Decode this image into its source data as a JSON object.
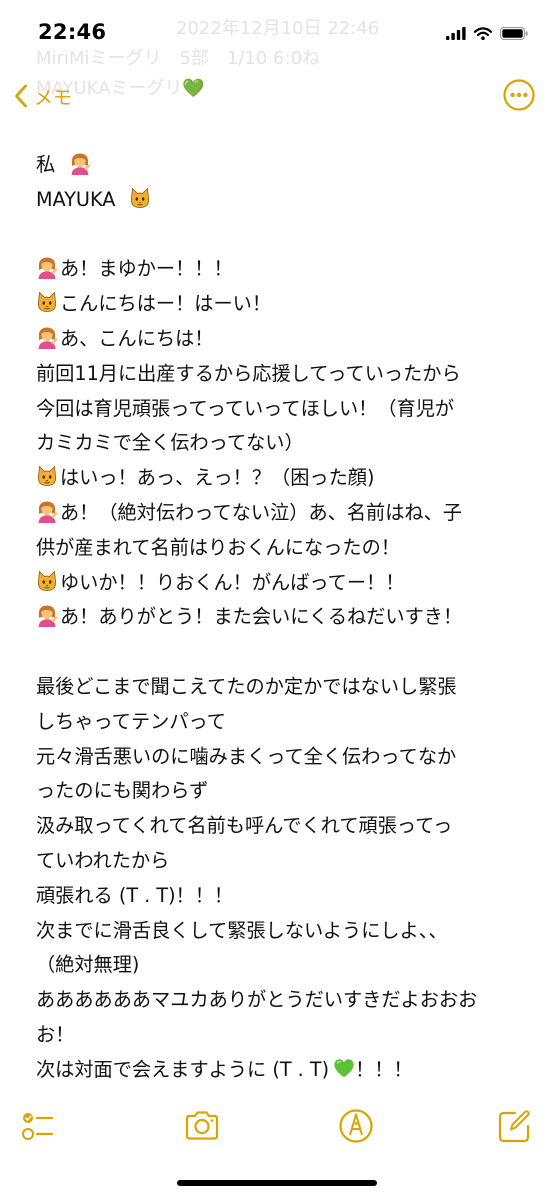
{
  "status_bar": {
    "time": "22:46",
    "icons": [
      "signal-icon",
      "wifi-icon",
      "battery-icon"
    ]
  },
  "ghost_header": {
    "line1": "2022年12月10日 22:46",
    "line2": "MiriMiミーグリ　5部　1/10 6:0ね",
    "line3": "MAYUKAミーグリ💚"
  },
  "nav": {
    "back_label": "メモ",
    "more_icon": "ellipsis-circle-icon"
  },
  "note": {
    "header_me": "私",
    "header_mayuka": "MAYUKA",
    "lines": [
      "あ！まゆかー！！！",
      "こんにちはー！はーい！",
      "あ、こんにちは！",
      "前回11月に出産するから応援してっていったから",
      "今回は育児頑張ってっていってほしい！（育児が",
      "カミカミで全く伝わってない）",
      "はいっ！あっ、えっ！？（困った顔)",
      "あ！（絶対伝わってない泣）あ、名前はね、子",
      "供が産まれて名前はりおくんになったの！",
      "ゆいか！！りおくん！がんばってー！！",
      "あ！ありがとう！また会いにくるねだいすき！",
      "最後どこまで聞こえてたのか定かではないし緊張",
      "しちゃってテンパって",
      "元々滑舌悪いのに噛みまくって全く伝わってなか",
      "ったのにも関わらず",
      "汲み取ってくれて名前も呼んでくれて頑張ってっ",
      "ていわれたから",
      "頑張れる (T . T)！！！",
      "次までに滑舌良くして緊張しないようにしよ、、",
      "（絶対無理)",
      "ああああああマユカありがとうだいすきだよおおお",
      "お！",
      "次は対面で会えますように (T . T)",
      "！！！"
    ]
  },
  "toolbar": {
    "icons": [
      "checklist-icon",
      "camera-icon",
      "markup-pen-icon",
      "compose-icon"
    ]
  },
  "colors": {
    "accent": "#d9a400",
    "text": "#111111",
    "ghost": "#e3e3e3",
    "heart": "#5bc236"
  }
}
